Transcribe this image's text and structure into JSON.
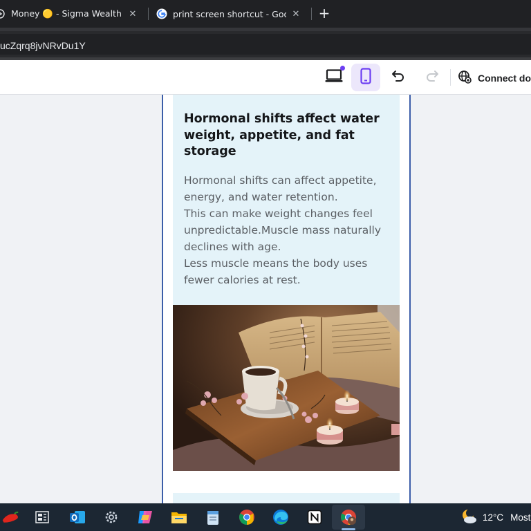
{
  "browser": {
    "tabs": [
      {
        "title": "Money 🟡 - Sigma Wealth Plan",
        "active": false
      },
      {
        "title": "print screen shortcut - Google Se",
        "active": false
      }
    ],
    "new_tab_glyph": "+",
    "close_glyph": "✕",
    "address_text": "ucZqrq8jvNRvDu1Y"
  },
  "toolbar": {
    "connect_label": "Connect do",
    "accent_color": "#6c3ef2",
    "icons": [
      "desktop-view-icon",
      "mobile-view-icon",
      "undo-icon",
      "redo-icon",
      "globe-icon"
    ]
  },
  "content": {
    "card_title": "Hormonal shifts affect water weight, appetite, and fat storage",
    "body_lines": [
      "Hormonal shifts can affect appetite,",
      "energy, and water retention.",
      "This can make weight changes feel",
      "unpredictable.Muscle mass naturally",
      "declines with age.",
      "Less muscle means the body uses",
      "fewer calories at rest."
    ],
    "card_color": "#e4f3f9",
    "frame_color": "#3b5da8"
  },
  "taskbar": {
    "temperature": "12°C",
    "weather_text": "Most",
    "apps": [
      "pepper-icon",
      "widgets-icon",
      "outlook-icon",
      "settings-icon",
      "copilot-icon",
      "file-explorer-icon",
      "notepad-icon",
      "chrome-icon",
      "edge-icon",
      "notion-icon",
      "chrome-profile-icon"
    ]
  }
}
